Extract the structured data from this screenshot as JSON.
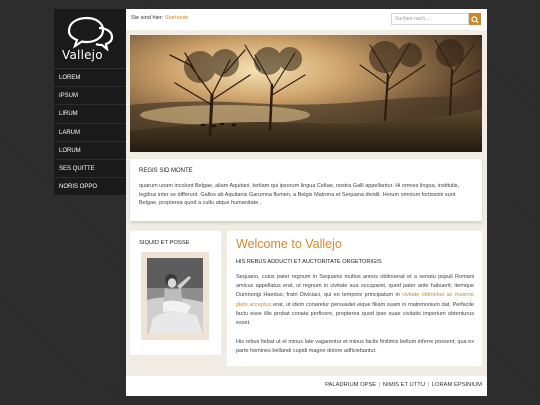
{
  "logo": {
    "text": "Vallejo"
  },
  "nav": {
    "items": [
      {
        "label": "LOREM"
      },
      {
        "label": "IPSUM"
      },
      {
        "label": "LIRUM"
      },
      {
        "label": "LARUM"
      },
      {
        "label": "LORUM"
      },
      {
        "label": "SES QUITTE"
      },
      {
        "label": "NORIS OPPO"
      }
    ]
  },
  "topbar": {
    "breadcrumb_prefix": "Sie sind hier:",
    "breadcrumb_current": "Startseite",
    "search_placeholder": "Suchen nach ..."
  },
  "intro": {
    "title": "REGIS SID MONTE",
    "text": "quarum unam incolunt Belgae, aliam Aquitani, tertiam qui ipsorum lingua Celtae, nostra Galli appellantur. Hi omnes lingua, institutis, legibus inter se differunt. Gallos ab Aquitanis Garumna flumen, a Belgis Matrona et Sequana dividit. Horum omnium fortissimi sunt Belgae, propterea quod a cultu atque humanitate ."
  },
  "side_panel": {
    "title": "SIQUID ET POSSE"
  },
  "content": {
    "heading": "Welcome to Vallejo",
    "subheading": "HIS REBUS ADDUCTI ET AUCTORITATE ORGETORIGIS",
    "para1_before": "Sequano, cuius pater regnum in Sequanis multos annos obtinuerat et a senatu populi Romani amicus appellatus erat, ut regnum in civitate sua occuparet, quod pater ante habuerit; itemque Dumnorigi Haeduo, fratri Diviciaci, qui eo tempore principatum in ",
    "para1_link": "civitate obtinebat ac maxime plebi acceptus",
    "para1_after": " erat, ut idem conaretur persuadet eique filiam suam in matrimonium dat. Perfacile factu esse illis probat conata perficere, propterea quod ipse suae civitatis imperium obtenturus esset.",
    "para2": "His rebus fiebat ut et minus late vagarentur et minus facile finitimis bellum inferre possent; qua ex parte homines bellandi cupidi magno dolore adficiebantur."
  },
  "footer": {
    "links": [
      {
        "label": "PALADRIUM OPSE"
      },
      {
        "label": "NIMIS ET UTTU"
      },
      {
        "label": "LORAM EPSINIUM"
      }
    ]
  },
  "colors": {
    "accent": "#d2892e",
    "sidebar": "#1a1a1a",
    "background": "#2b2b2b"
  }
}
